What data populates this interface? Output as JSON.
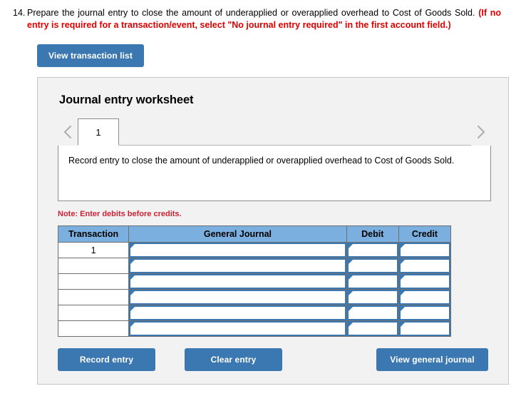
{
  "question": {
    "number": "14.",
    "text_plain": "Prepare the journal entry to close the amount of underapplied or overapplied overhead to Cost of Goods Sold. ",
    "text_emphasis": "(If no entry is required for a transaction/event, select \"No journal entry required\" in the first account field.)"
  },
  "toolbar": {
    "view_transaction_list_label": "View transaction list"
  },
  "panel": {
    "title": "Journal entry worksheet",
    "nav": {
      "prev_icon": "chevron-left-icon",
      "next_icon": "chevron-right-icon"
    },
    "tabs": [
      {
        "label": "1",
        "active": true
      }
    ],
    "description": "Record entry to close the amount of underapplied or overapplied overhead to Cost of Goods Sold.",
    "note": "Note: Enter debits before credits."
  },
  "table": {
    "headers": [
      "Transaction",
      "General Journal",
      "Debit",
      "Credit"
    ],
    "rows": [
      {
        "transaction": "1",
        "general_journal": "",
        "debit": "",
        "credit": ""
      },
      {
        "transaction": "",
        "general_journal": "",
        "debit": "",
        "credit": ""
      },
      {
        "transaction": "",
        "general_journal": "",
        "debit": "",
        "credit": ""
      },
      {
        "transaction": "",
        "general_journal": "",
        "debit": "",
        "credit": ""
      },
      {
        "transaction": "",
        "general_journal": "",
        "debit": "",
        "credit": ""
      },
      {
        "transaction": "",
        "general_journal": "",
        "debit": "",
        "credit": ""
      }
    ]
  },
  "actions": {
    "record_entry_label": "Record entry",
    "clear_entry_label": "Clear entry",
    "view_general_journal_label": "View general journal"
  },
  "colors": {
    "button_blue": "#3b77b0",
    "header_blue": "#7aafdf",
    "note_red": "#cc2233",
    "emphasis_red": "#e00000",
    "panel_gray": "#f2f2f2"
  }
}
